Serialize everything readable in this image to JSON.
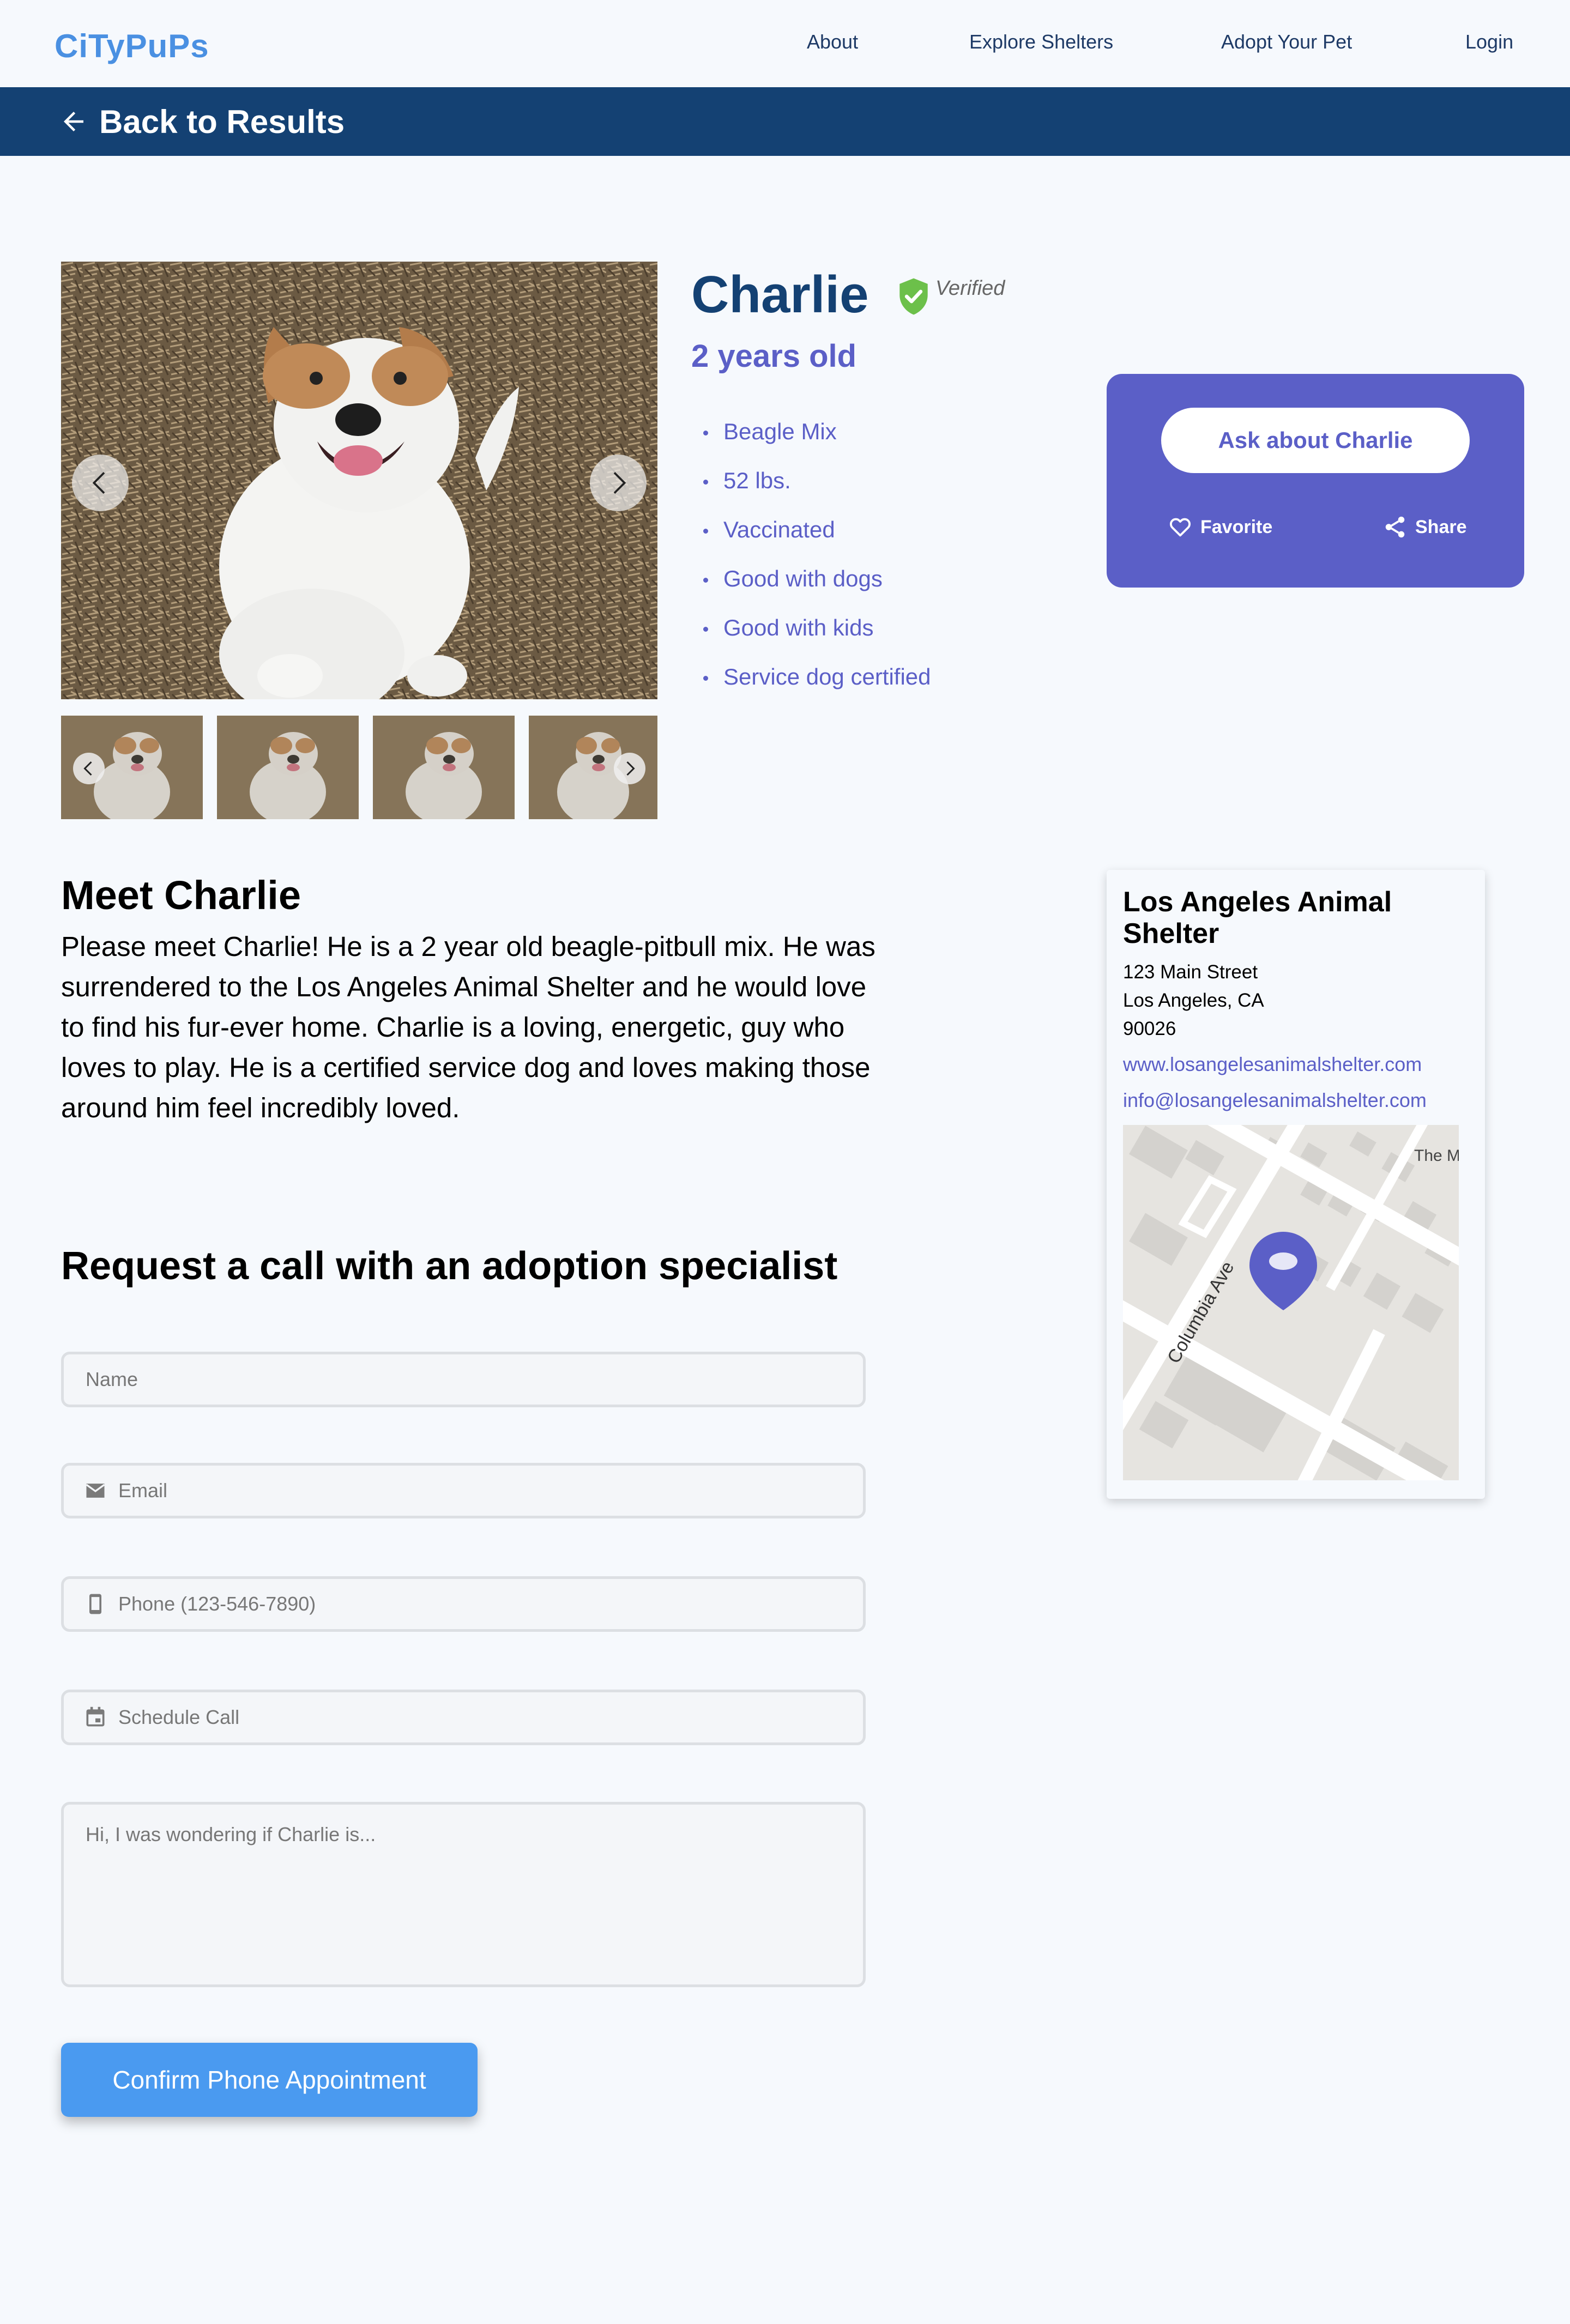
{
  "nav": {
    "logo": "CiTyPuPs",
    "links": [
      "About",
      "Explore Shelters",
      "Adopt Your Pet",
      "Login"
    ]
  },
  "back_bar": {
    "label": "Back to Results"
  },
  "pet": {
    "name": "Charlie",
    "verified_label": "Verified",
    "age": "2 years old",
    "traits": [
      "Beagle Mix",
      "52 lbs.",
      "Vaccinated",
      "Good with dogs",
      "Good with kids",
      "Service dog certified"
    ]
  },
  "ask_card": {
    "ask_label": "Ask about Charlie",
    "favorite_label": "Favorite",
    "share_label": "Share"
  },
  "meet": {
    "title": "Meet Charlie",
    "text": "Please meet Charlie! He is a 2 year old beagle-pitbull mix. He was surrendered to the Los Angeles Animal  Shelter and he would love to find his fur-ever home. Charlie is a loving, energetic, guy who loves to play.  He is a certified service dog and loves making those around him feel incredibly loved."
  },
  "request": {
    "title": "Request a call with an adoption specialist",
    "name_placeholder": "Name",
    "email_placeholder": "Email",
    "phone_placeholder": "Phone (123-546-7890)",
    "schedule_placeholder": "Schedule Call",
    "message_placeholder": "Hi, I was wondering if Charlie is...",
    "submit_label": "Confirm Phone Appointment"
  },
  "shelter": {
    "name": "Los Angeles Animal Shelter",
    "address_line1": "123 Main Street",
    "address_line2": "Los Angeles, CA",
    "address_line3": "90026",
    "website": "www.losangelesanimalshelter.com",
    "email": "info@losangelesanimalshelter.com",
    "map_street_label": "Columbia Ave",
    "map_corner_label": "The M"
  },
  "colors": {
    "brand_blue": "#4a90e2",
    "navy": "#144173",
    "accent_purple": "#5b5fc7",
    "verified_green": "#6cc04a",
    "button_blue": "#4a9af0"
  },
  "icons": [
    "arrow-left-icon",
    "verified-shield-icon",
    "chevron-left-icon",
    "chevron-right-icon",
    "heart-icon",
    "share-icon",
    "email-icon",
    "phone-icon",
    "calendar-icon",
    "map-pin-icon"
  ]
}
